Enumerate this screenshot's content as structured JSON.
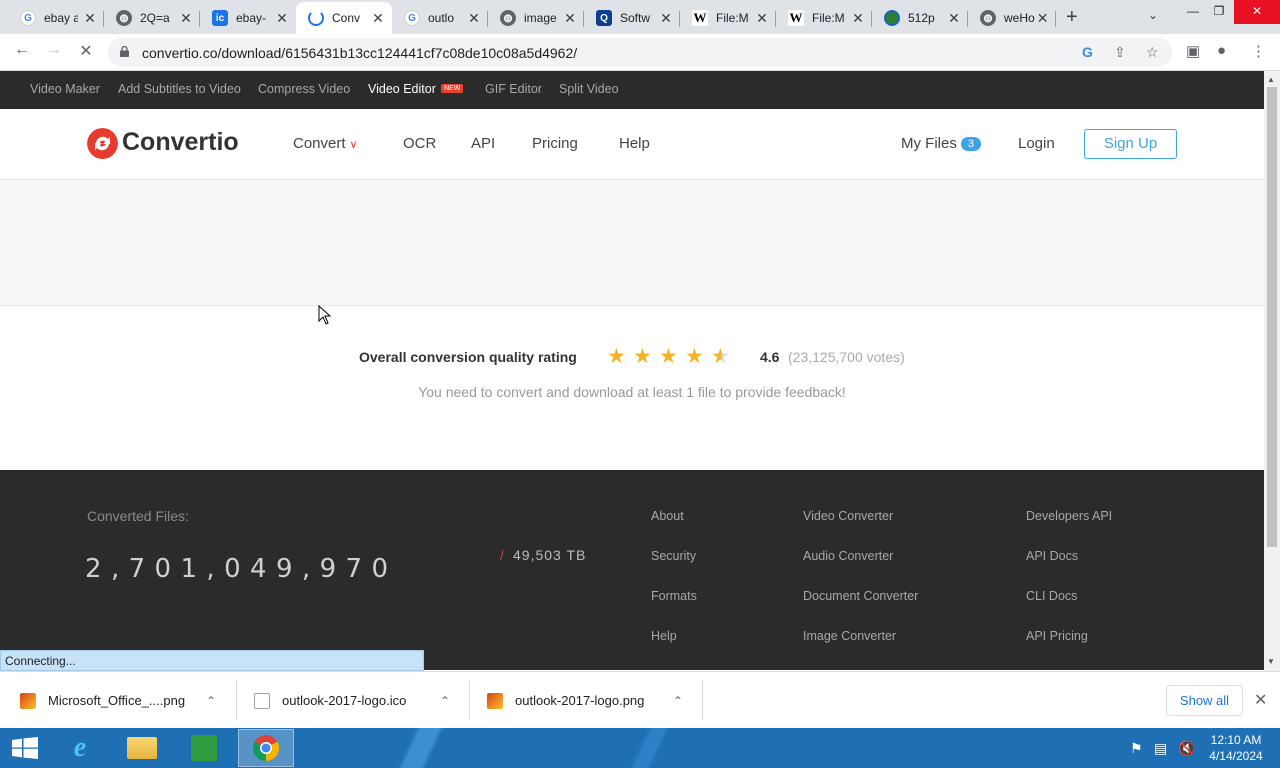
{
  "browser": {
    "tabs": [
      {
        "title": "ebay a",
        "favicon": "google-icon"
      },
      {
        "title": "2Q=a",
        "favicon": "globe-icon"
      },
      {
        "title": "ebay-",
        "favicon": "ic-icon"
      },
      {
        "title": "Conv",
        "favicon": "loading-icon"
      },
      {
        "title": "outlo",
        "favicon": "google-icon"
      },
      {
        "title": "image",
        "favicon": "globe-icon"
      },
      {
        "title": "Softw",
        "favicon": "search-icon"
      },
      {
        "title": "File:M",
        "favicon": "wikipedia-icon"
      },
      {
        "title": "File:M",
        "favicon": "wikipedia-icon"
      },
      {
        "title": "512p",
        "favicon": "circle-icon"
      },
      {
        "title": "weHo",
        "favicon": "globe-icon"
      }
    ],
    "active_tab": 3,
    "url": "convertio.co/download/6156431b13cc124441cf7c08de10c08a5d4962/"
  },
  "site": {
    "topbar": [
      {
        "label": "Video Maker"
      },
      {
        "label": "Add Subtitles to Video"
      },
      {
        "label": "Compress Video"
      },
      {
        "label": "Video Editor",
        "badge": "NEW"
      },
      {
        "label": "GIF Editor"
      },
      {
        "label": "Split Video"
      }
    ],
    "logo": "Convertio",
    "nav": {
      "convert": "Convert",
      "ocr": "OCR",
      "api": "API",
      "pricing": "Pricing",
      "help": "Help",
      "my_files": "My Files",
      "my_files_count": "3",
      "login": "Login",
      "signup": "Sign Up"
    },
    "rating": {
      "label": "Overall conversion quality rating",
      "stars": 4.6,
      "score": "4.6",
      "votes": "(23,125,700 votes)",
      "feedback": "You need to convert and download at least 1 file to provide feedback!"
    },
    "footer": {
      "converted_label": "Converted Files:",
      "converted_count": "2,701,049,970",
      "tb_slash": "/",
      "tb": "49,503 TB",
      "col1": [
        "About",
        "Security",
        "Formats",
        "Help"
      ],
      "col2": [
        "Video Converter",
        "Audio Converter",
        "Document Converter",
        "Image Converter"
      ],
      "col3": [
        "Developers API",
        "API Docs",
        "CLI Docs",
        "API Pricing"
      ]
    }
  },
  "status_text": "Connecting...",
  "downloads": {
    "items": [
      {
        "name": "Microsoft_Office_....png"
      },
      {
        "name": "outlook-2017-logo.ico"
      },
      {
        "name": "outlook-2017-logo.png"
      }
    ],
    "show_all": "Show all"
  },
  "taskbar": {
    "time": "12:10 AM",
    "date": "4/14/2024"
  },
  "colors": {
    "brand_red": "#e63b2e",
    "accent_blue": "#3ea4e8",
    "star": "#f5b324"
  }
}
